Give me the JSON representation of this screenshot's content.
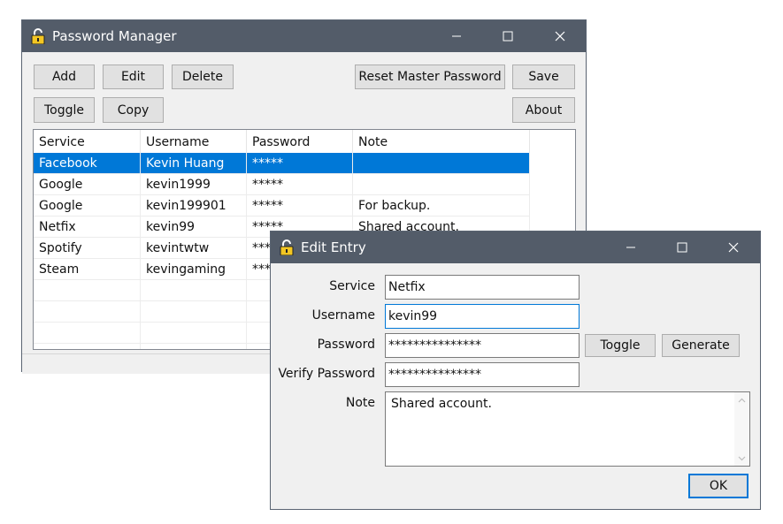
{
  "main": {
    "title": "Password Manager",
    "buttons": {
      "add": "Add",
      "edit": "Edit",
      "delete": "Delete",
      "reset": "Reset Master Password",
      "save": "Save",
      "toggle": "Toggle",
      "copy": "Copy",
      "about": "About"
    },
    "columns": [
      "Service",
      "Username",
      "Password",
      "Note"
    ],
    "rows": [
      {
        "service": "Facebook",
        "username": "Kevin Huang",
        "password": "*****",
        "note": ""
      },
      {
        "service": "Google",
        "username": "kevin1999",
        "password": "*****",
        "note": ""
      },
      {
        "service": "Google",
        "username": "kevin199901",
        "password": "*****",
        "note": "For backup."
      },
      {
        "service": "Netfix",
        "username": "kevin99",
        "password": "*****",
        "note": "Shared account."
      },
      {
        "service": "Spotify",
        "username": "kevintwtw",
        "password": "*****",
        "note": ""
      },
      {
        "service": "Steam",
        "username": "kevingaming",
        "password": "*****",
        "note": ""
      }
    ],
    "selected_row": 0
  },
  "edit": {
    "title": "Edit Entry",
    "labels": {
      "service": "Service",
      "username": "Username",
      "password": "Password",
      "verify": "Verify Password",
      "note": "Note"
    },
    "values": {
      "service": "Netfix",
      "username": "kevin99",
      "password": "***************",
      "verify": "***************",
      "note": "Shared account."
    },
    "buttons": {
      "toggle": "Toggle",
      "generate": "Generate",
      "ok": "OK"
    }
  },
  "colors": {
    "titlebar": "#535c69",
    "selection": "#0078d7",
    "window_bg": "#f0f0f0"
  },
  "icons": [
    "lock-icon",
    "minimize-icon",
    "maximize-icon",
    "close-icon",
    "scroll-up-icon",
    "scroll-down-icon"
  ]
}
